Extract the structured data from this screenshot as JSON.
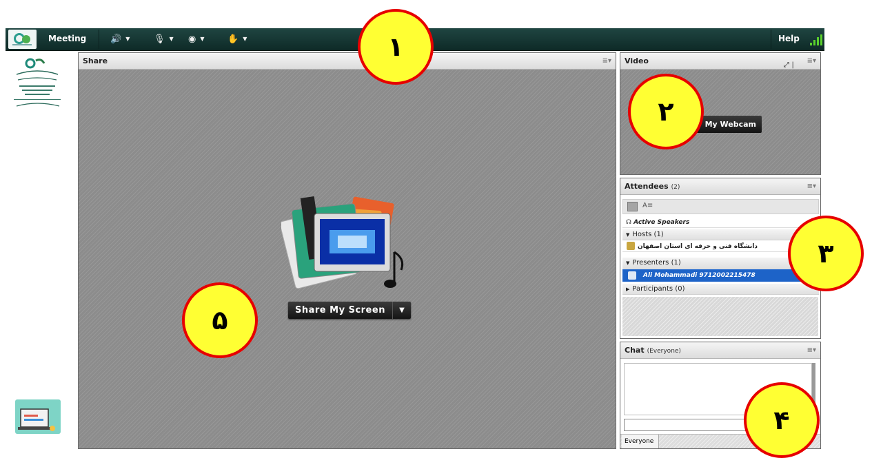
{
  "menubar": {
    "meeting_label": "Meeting",
    "help_label": "Help",
    "tools": [
      {
        "icon": "speaker-icon",
        "glyph": "🔊"
      },
      {
        "icon": "microphone-icon",
        "glyph": "🎙"
      },
      {
        "icon": "webcam-icon",
        "glyph": "◉"
      },
      {
        "icon": "raise-hand-icon",
        "glyph": "✋"
      }
    ]
  },
  "share": {
    "title": "Share",
    "button_label": "Share My Screen"
  },
  "video": {
    "title": "Video",
    "webcam_button": "My Webcam"
  },
  "attendees": {
    "title": "Attendees",
    "count": "(2)",
    "active_speakers": "Active Speakers",
    "hosts_label": "Hosts (1)",
    "host_name": "دانشگاه فنی و حرفه ای استان اصفهان",
    "presenters_label": "Presenters (1)",
    "presenter_name": "Ali Mohammadi 9712002215478",
    "participants_label": "Participants (0)"
  },
  "chat": {
    "title": "Chat",
    "scope": "(Everyone)",
    "tab_label": "Everyone"
  },
  "callouts": [
    "١",
    "٢",
    "٣",
    "۴",
    "۵"
  ],
  "colors": {
    "menubar": "#12332f",
    "callout_fill": "#ffff33",
    "callout_border": "#e60000",
    "presenter_highlight": "#1d63c8"
  }
}
